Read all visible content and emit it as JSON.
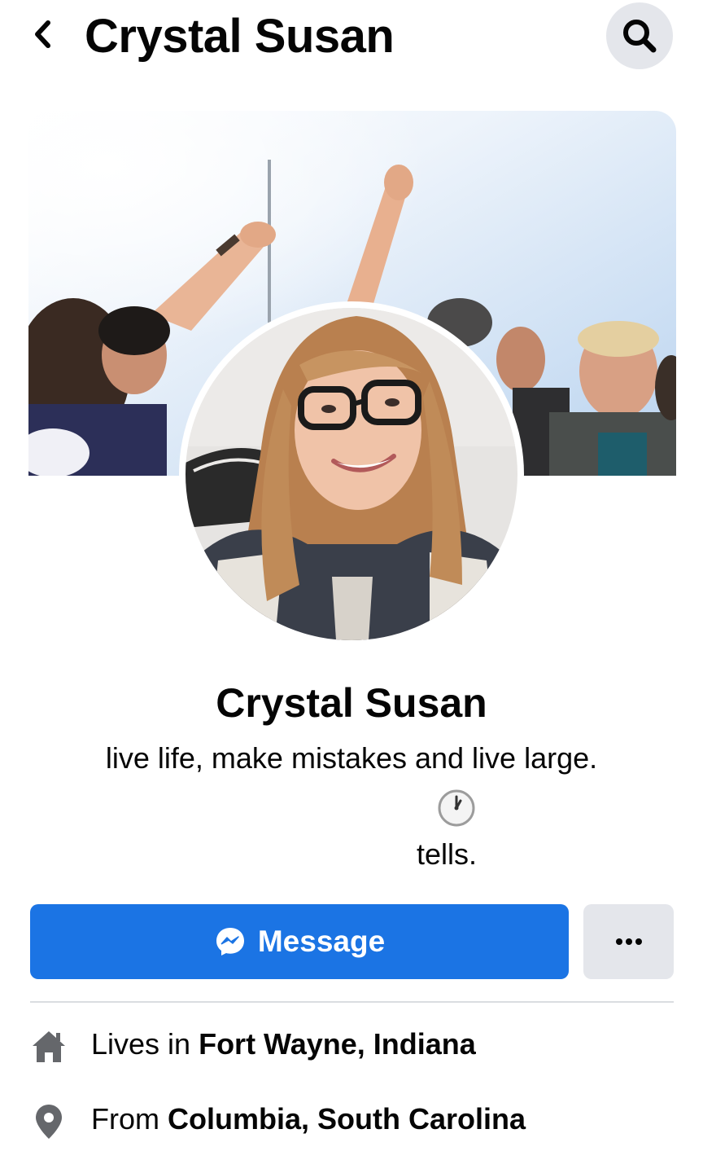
{
  "header": {
    "title": "Crystal Susan",
    "back_icon": "chevron-left-icon",
    "search_icon": "search-icon"
  },
  "profile": {
    "name": "Crystal Susan",
    "bio_line1": "live life, make mistakes and live large.",
    "bio_emoji": "clock-icon",
    "bio_line2": "tells."
  },
  "actions": {
    "message_label": "Message",
    "message_icon": "messenger-icon",
    "more_icon": "more-dots-icon"
  },
  "details": [
    {
      "icon": "home-icon",
      "prefix": "Lives in",
      "value": "Fort Wayne, Indiana"
    },
    {
      "icon": "location-pin-icon",
      "prefix": "From",
      "value": "Columbia, South Carolina"
    }
  ],
  "colors": {
    "accent": "#1b74e4",
    "secondary_button": "#e4e6eb",
    "icon_gray": "#65676b"
  }
}
